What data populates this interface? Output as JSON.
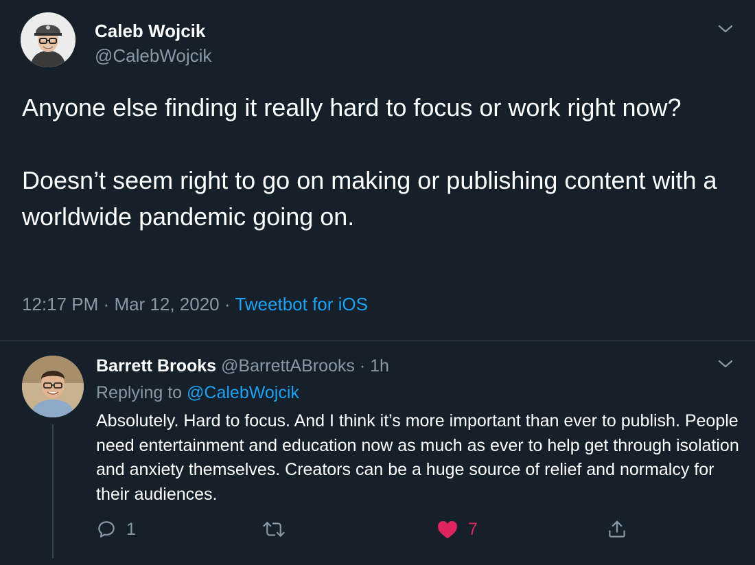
{
  "main_tweet": {
    "author_name": "Caleb Wojcik",
    "author_handle": "@CalebWojcik",
    "text_line_1": "Anyone else finding it really hard to focus or work right now?",
    "text_line_2": "Doesn’t seem right to go on making or publishing content with a worldwide pandemic going on.",
    "time": "12:17 PM",
    "date": "Mar 12, 2020",
    "separator": "·",
    "source": "Tweetbot for iOS",
    "avatar_icon": "person-with-cap-avatar",
    "menu_icon": "chevron-down-icon"
  },
  "reply": {
    "author_name": "Barrett Brooks",
    "author_handle": "@BarrettABrooks",
    "separator": "·",
    "age": "1h",
    "replying_to_label": "Replying to",
    "replying_to_handle": "@CalebWojcik",
    "text": "Absolutely. Hard to focus. And I think it’s more important than ever to publish. People need entertainment and education now as much as ever to help get through isolation and anxiety themselves. Creators can be a huge source of relief and normalcy for their audiences.",
    "avatar_icon": "person-avatar",
    "menu_icon": "chevron-down-icon"
  },
  "actions": {
    "reply_count": "1",
    "retweet_count": "",
    "like_count": "7",
    "liked": true
  },
  "colors": {
    "background": "#15202b",
    "text_primary": "#ffffff",
    "text_secondary": "#8899a6",
    "accent_link": "#1da1f2",
    "like_red": "#e0245e",
    "divider": "#38444d"
  }
}
